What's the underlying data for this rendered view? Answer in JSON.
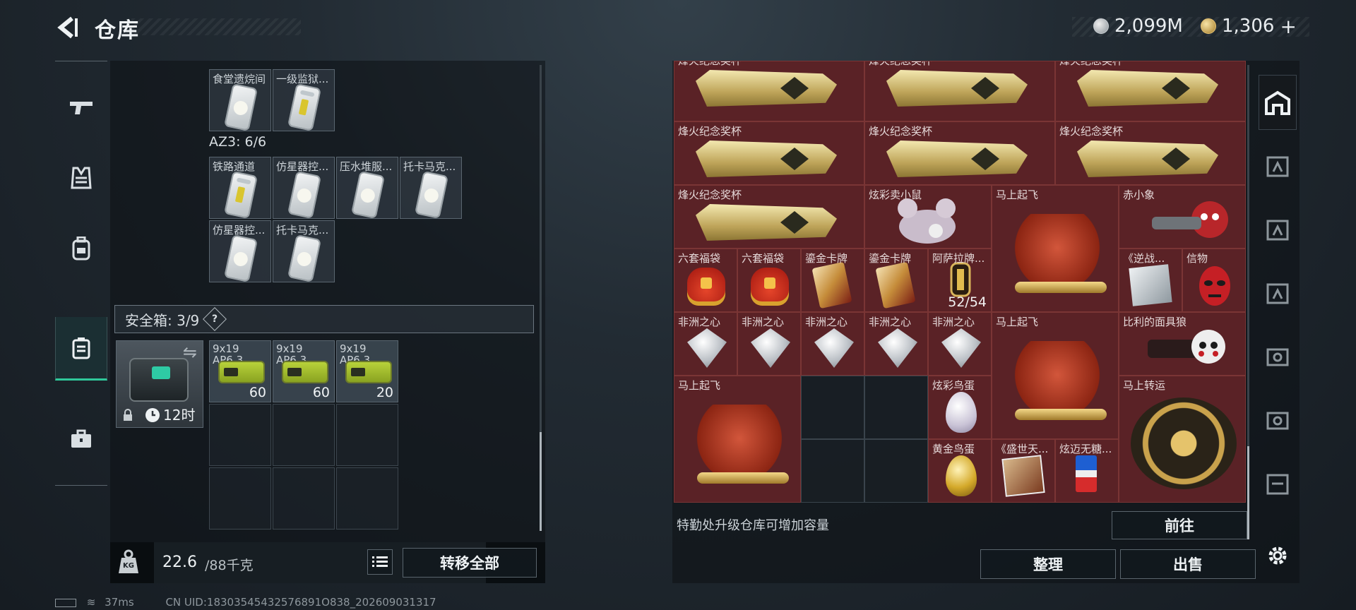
{
  "header": {
    "title": "仓库"
  },
  "currency": {
    "silver": "2,099M",
    "gold": "1,306",
    "gold_add": "+"
  },
  "nav": {
    "items": [
      "weapons",
      "armor",
      "backpack",
      "safe-container",
      "case"
    ]
  },
  "left": {
    "row_top": [
      {
        "name": "食堂遗烷间"
      },
      {
        "name": "一级监狱..."
      }
    ],
    "az3_label": "AZ3: 6/6",
    "az3_items": [
      {
        "name": "铁路通道"
      },
      {
        "name": "仿星器控..."
      },
      {
        "name": "压水堆服..."
      },
      {
        "name": "托卡马克..."
      },
      {
        "name": "仿星器控..."
      },
      {
        "name": "托卡马克..."
      }
    ],
    "safebox": {
      "label": "安全箱: 3/9",
      "question": "?",
      "timer": "12时",
      "swap": "⇋"
    },
    "ammo": [
      {
        "name": "9x19",
        "sub": "AP6.3",
        "count": "60"
      },
      {
        "name": "9x19",
        "sub": "AP6.3",
        "count": "60"
      },
      {
        "name": "9x19",
        "sub": "AP6.3",
        "count": "20"
      }
    ],
    "weight": {
      "value": "22.6",
      "max": "/88千克",
      "kg_badge": "KG"
    },
    "transfer_all": "转移全部"
  },
  "right": {
    "trophy_name": "烽火纪念奖杯",
    "items": {
      "mouse": "炫彩卖小鼠",
      "horse": "马上起飞",
      "elephant": "赤小象",
      "bag": "六套福袋",
      "card": "鎏金卡牌",
      "asara": "阿萨拉牌...",
      "asara_count": "52/54",
      "war": "《逆战...",
      "token": "信物",
      "diamond": "非洲之心",
      "billy": "比利的面具狼",
      "egg_color": "炫彩鸟蛋",
      "lucky": "马上转运",
      "egg_gold": "黄金鸟蛋",
      "shengshi": "《盛世天...",
      "candy": "炫迈无糖..."
    },
    "note": "特勤处升级仓库可增加容量",
    "goto": "前往",
    "sort": "整理",
    "sell": "出售"
  },
  "status": {
    "ping": "37ms",
    "uid": "CN UID:18303545432576891O838_202609031317"
  }
}
